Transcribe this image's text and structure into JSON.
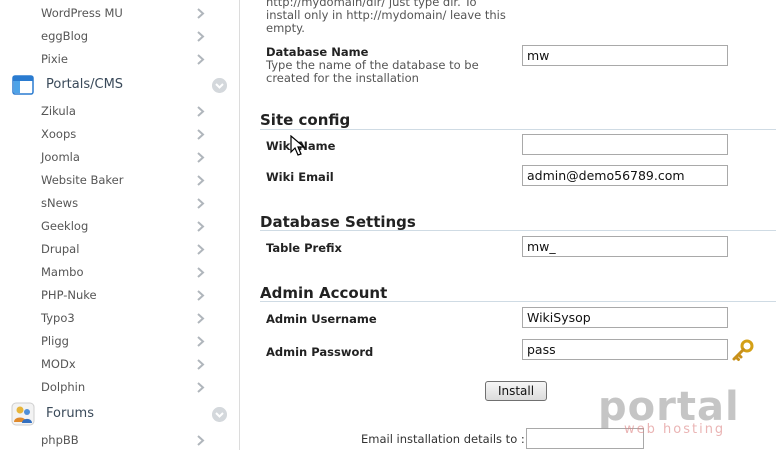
{
  "sidebar": {
    "items_top": [
      {
        "label": "WordPress MU"
      },
      {
        "label": "eggBlog"
      },
      {
        "label": "Pixie"
      }
    ],
    "category_portals": {
      "label": "Portals/CMS"
    },
    "items_portals": [
      {
        "label": "Zikula"
      },
      {
        "label": "Xoops"
      },
      {
        "label": "Joomla"
      },
      {
        "label": "Website Baker"
      },
      {
        "label": "sNews"
      },
      {
        "label": "Geeklog"
      },
      {
        "label": "Drupal"
      },
      {
        "label": "Mambo"
      },
      {
        "label": "PHP-Nuke"
      },
      {
        "label": "Typo3"
      },
      {
        "label": "Pligg"
      },
      {
        "label": "MODx"
      },
      {
        "label": "Dolphin"
      }
    ],
    "category_forums": {
      "label": "Forums"
    },
    "items_forums": [
      {
        "label": "phpBB"
      }
    ]
  },
  "install_dir": {
    "hint_line1": "http://mydomain/dir/ just type dir. To",
    "hint_line2": "install only in http://mydomain/ leave this",
    "hint_line3": "empty."
  },
  "database_name": {
    "label": "Database Name",
    "hint_line1": "Type the name of the database to be",
    "hint_line2": "created for the installation",
    "value": "mw"
  },
  "site_config": {
    "title": "Site config",
    "wiki_name_label": "Wiki Name",
    "wiki_name_value": "",
    "wiki_email_label": "Wiki Email",
    "wiki_email_value": "admin@demo56789.com"
  },
  "database_settings": {
    "title": "Database Settings",
    "table_prefix_label": "Table Prefix",
    "table_prefix_value": "mw_"
  },
  "admin_account": {
    "title": "Admin Account",
    "username_label": "Admin Username",
    "username_value": "WikiSysop",
    "password_label": "Admin Password",
    "password_value": "pass"
  },
  "install_button": {
    "label": "Install"
  },
  "email_details": {
    "label": "Email installation details to :",
    "value": ""
  },
  "watermark": {
    "text": "portal",
    "subtext": "web hosting"
  },
  "colors": {
    "accent_rule": "#cfdbe4",
    "key_icon": "#d4a017"
  }
}
